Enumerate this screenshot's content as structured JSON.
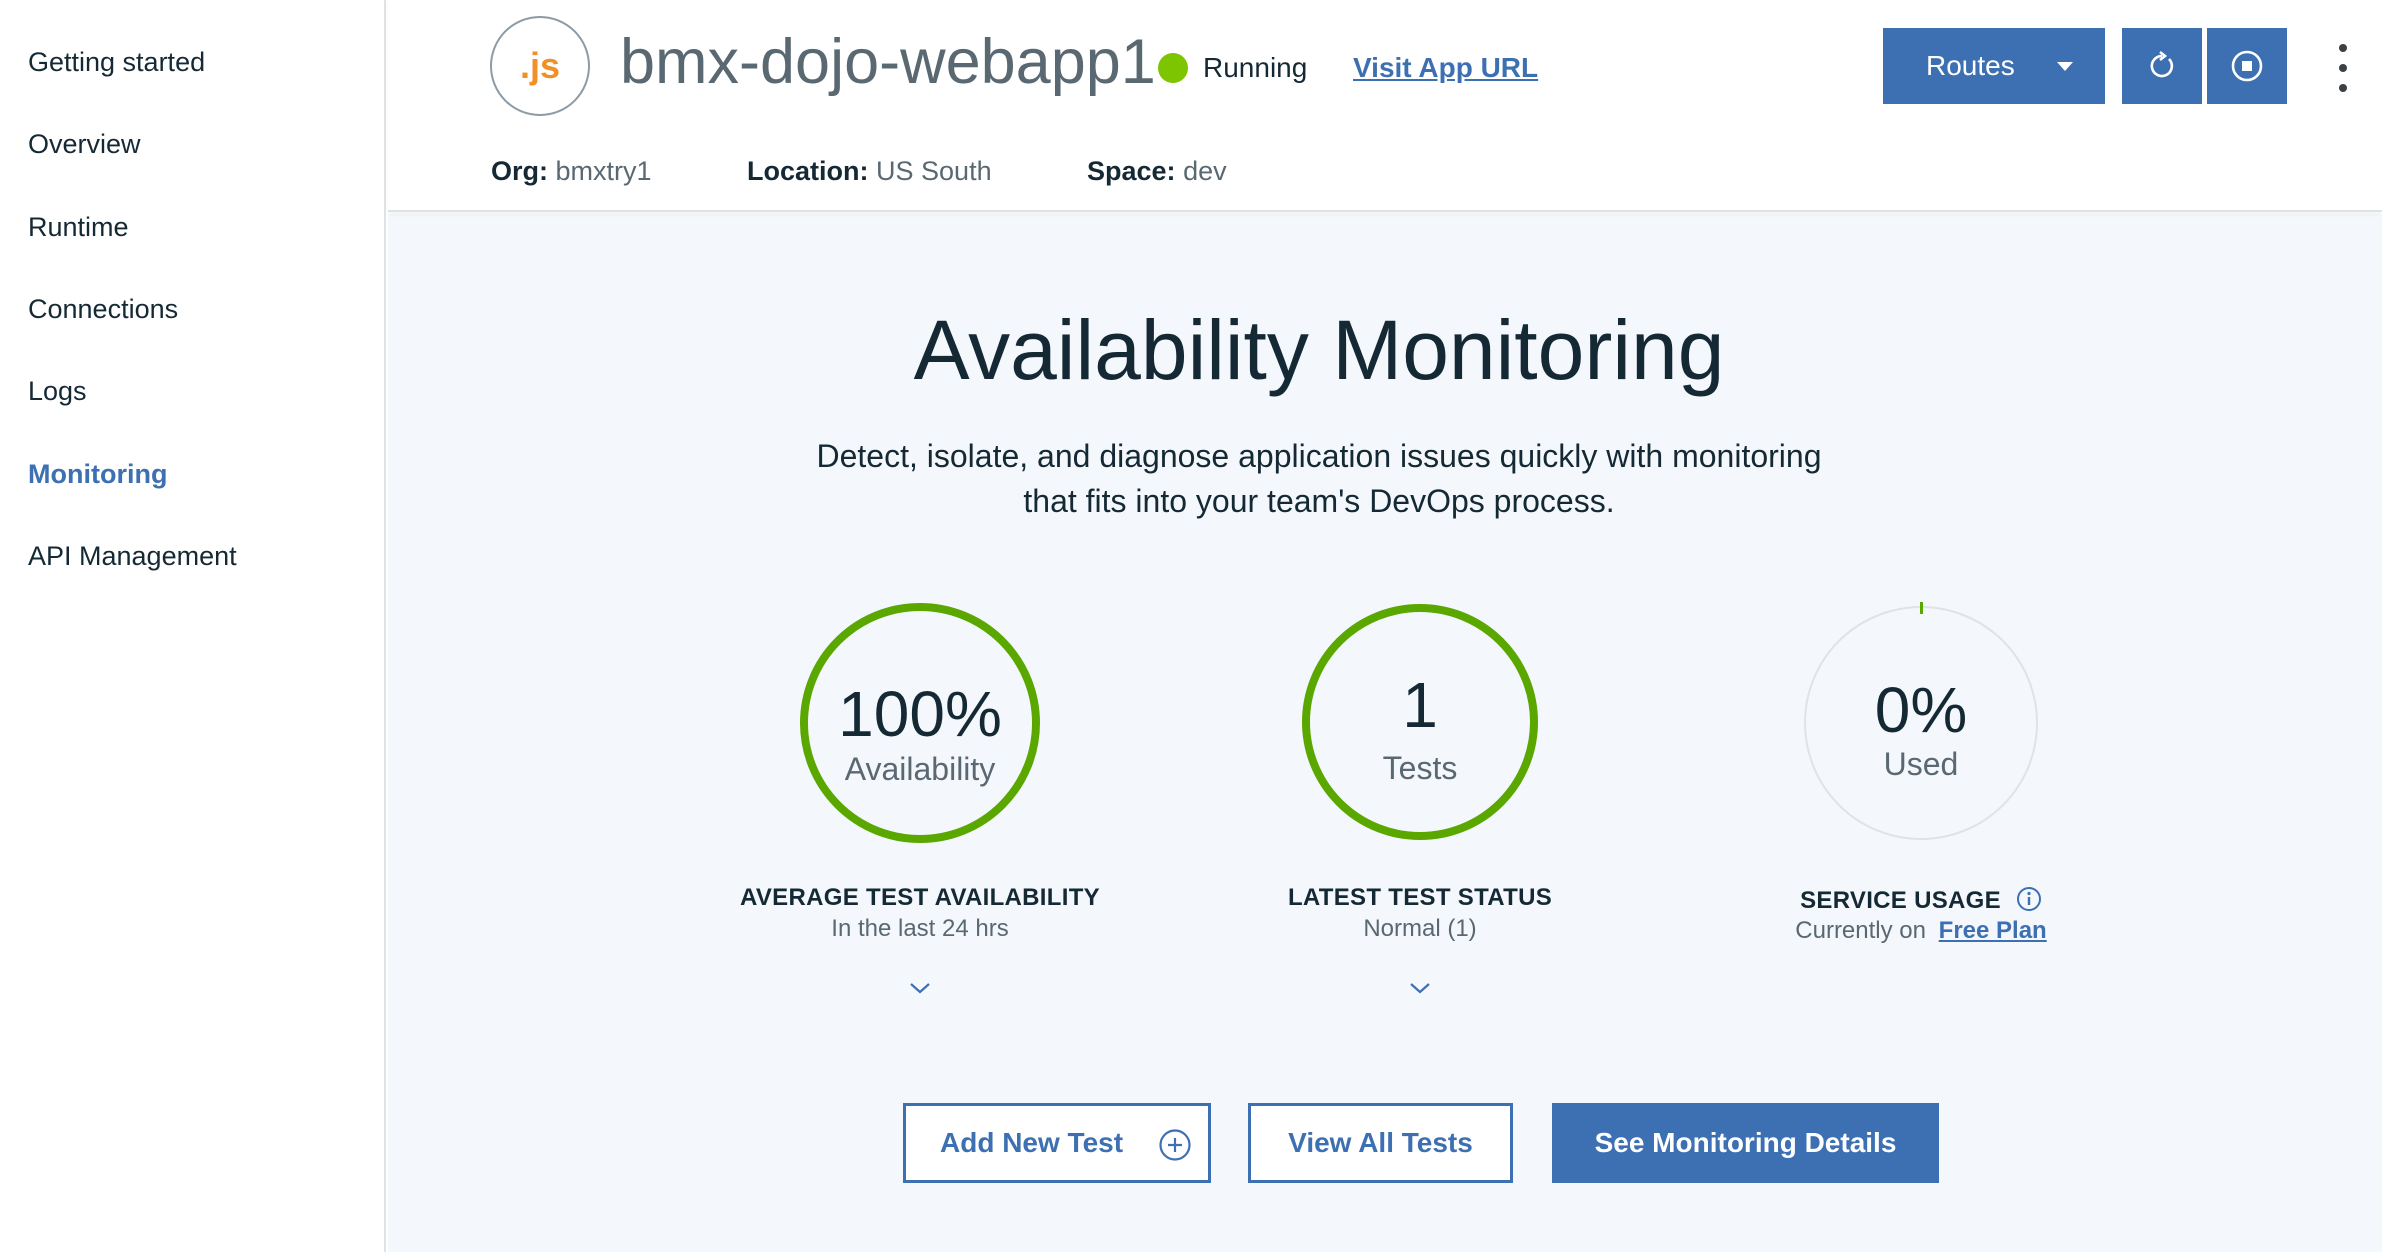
{
  "sidebar": {
    "items": [
      {
        "label": "Getting started"
      },
      {
        "label": "Overview"
      },
      {
        "label": "Runtime"
      },
      {
        "label": "Connections"
      },
      {
        "label": "Logs"
      },
      {
        "label": "Monitoring"
      },
      {
        "label": "API Management"
      }
    ],
    "active_item": "Monitoring"
  },
  "header": {
    "app_icon_text": ".js",
    "app_name": "bmx-dojo-webapp1",
    "status": "Running",
    "visit_link": "Visit App URL",
    "routes_label": "Routes",
    "org_label": "Org:",
    "org_value": "bmxtry1",
    "location_label": "Location:",
    "location_value": "US South",
    "space_label": "Space:",
    "space_value": "dev"
  },
  "main": {
    "title": "Availability Monitoring",
    "description_line1": "Detect, isolate, and diagnose application issues quickly with monitoring",
    "description_line2": "that fits into your team's DevOps process.",
    "stats": {
      "availability": {
        "value": "100%",
        "label": "Availability",
        "heading": "AVERAGE TEST AVAILABILITY",
        "sub": "In the last 24 hrs"
      },
      "tests": {
        "value": "1",
        "label": "Tests",
        "heading": "LATEST TEST STATUS",
        "sub": "Normal (1)"
      },
      "usage": {
        "value": "0%",
        "label": "Used",
        "heading": "SERVICE USAGE",
        "sub_prefix": "Currently on",
        "sub_link": "Free Plan"
      }
    },
    "buttons": {
      "add_test": "Add New Test",
      "view_all": "View All Tests",
      "see_details": "See Monitoring Details"
    }
  },
  "colors": {
    "accent": "#3d70b2",
    "success": "#5aa700",
    "status_running": "#7cc500",
    "js_orange": "#f19027"
  }
}
